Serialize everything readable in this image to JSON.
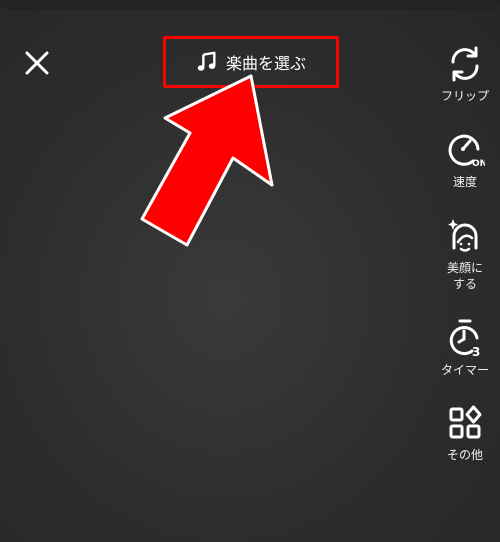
{
  "header": {
    "music_label": "楽曲を選ぶ"
  },
  "toolbar": {
    "flip_label": "フリップ",
    "speed_label": "速度",
    "speed_badge": "ON",
    "beauty_label_line1": "美顔に",
    "beauty_label_line2": "する",
    "timer_label": "タイマー",
    "timer_badge": "3",
    "more_label": "その他"
  },
  "colors": {
    "highlight": "#ff0000",
    "background": "#2c2c2c",
    "foreground": "#ffffff"
  },
  "icons": {
    "close": "close-icon",
    "music": "music-note-icon",
    "flip": "flip-camera-icon",
    "speed": "speed-gauge-icon",
    "beauty": "beauty-face-icon",
    "timer": "timer-icon",
    "more": "more-apps-icon"
  }
}
